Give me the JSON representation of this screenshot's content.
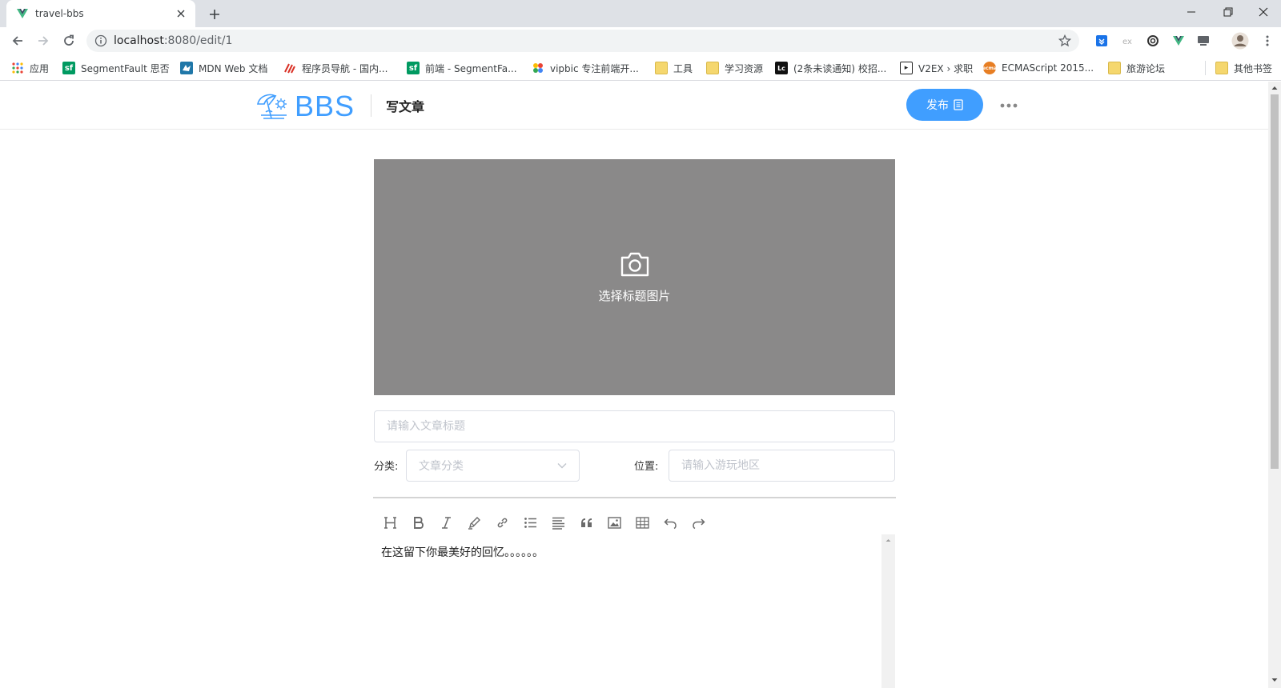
{
  "browser": {
    "tab": {
      "title": "travel-bbs"
    },
    "address": {
      "host": "localhost",
      "path": ":8080/edit/1"
    },
    "bookmarks": [
      {
        "label": "应用",
        "icon": "apps-grid-icon"
      },
      {
        "label": "SegmentFault 思否",
        "icon": "segmentfault-icon"
      },
      {
        "label": "MDN Web 文档",
        "icon": "mdn-icon"
      },
      {
        "label": "程序员导航 - 国内...",
        "icon": "coder-nav-icon"
      },
      {
        "label": "前端 - SegmentFa...",
        "icon": "segmentfault-icon"
      },
      {
        "label": "vipbic 专注前端开...",
        "icon": "vipbic-icon"
      },
      {
        "label": "工具",
        "icon": "folder-icon"
      },
      {
        "label": "学习资源",
        "icon": "folder-icon"
      },
      {
        "label": "(2条未读通知) 校招...",
        "icon": "niuke-icon"
      },
      {
        "label": "V2EX › 求职",
        "icon": "v2ex-icon"
      },
      {
        "label": "ECMAScript 2015...",
        "icon": "ecma-icon"
      },
      {
        "label": "旅游论坛",
        "icon": "folder-icon"
      },
      {
        "label": "其他书签",
        "icon": "folder-icon"
      }
    ]
  },
  "site": {
    "brand": "BBS",
    "page_title": "写文章",
    "publish_label": "发布"
  },
  "editor": {
    "cover_label": "选择标题图片",
    "title_placeholder": "请输入文章标题",
    "category_label": "分类:",
    "category_placeholder": "文章分类",
    "location_label": "位置:",
    "location_placeholder": "请输入游玩地区",
    "toolbar": [
      "heading",
      "bold",
      "italic",
      "strikethrough",
      "link",
      "unordered-list",
      "align",
      "quote",
      "image",
      "table",
      "undo",
      "redo"
    ],
    "content": "在这留下你最美好的回忆。。。。。。"
  },
  "colors": {
    "accent": "#409eff",
    "cover_bg": "#8a8989"
  }
}
